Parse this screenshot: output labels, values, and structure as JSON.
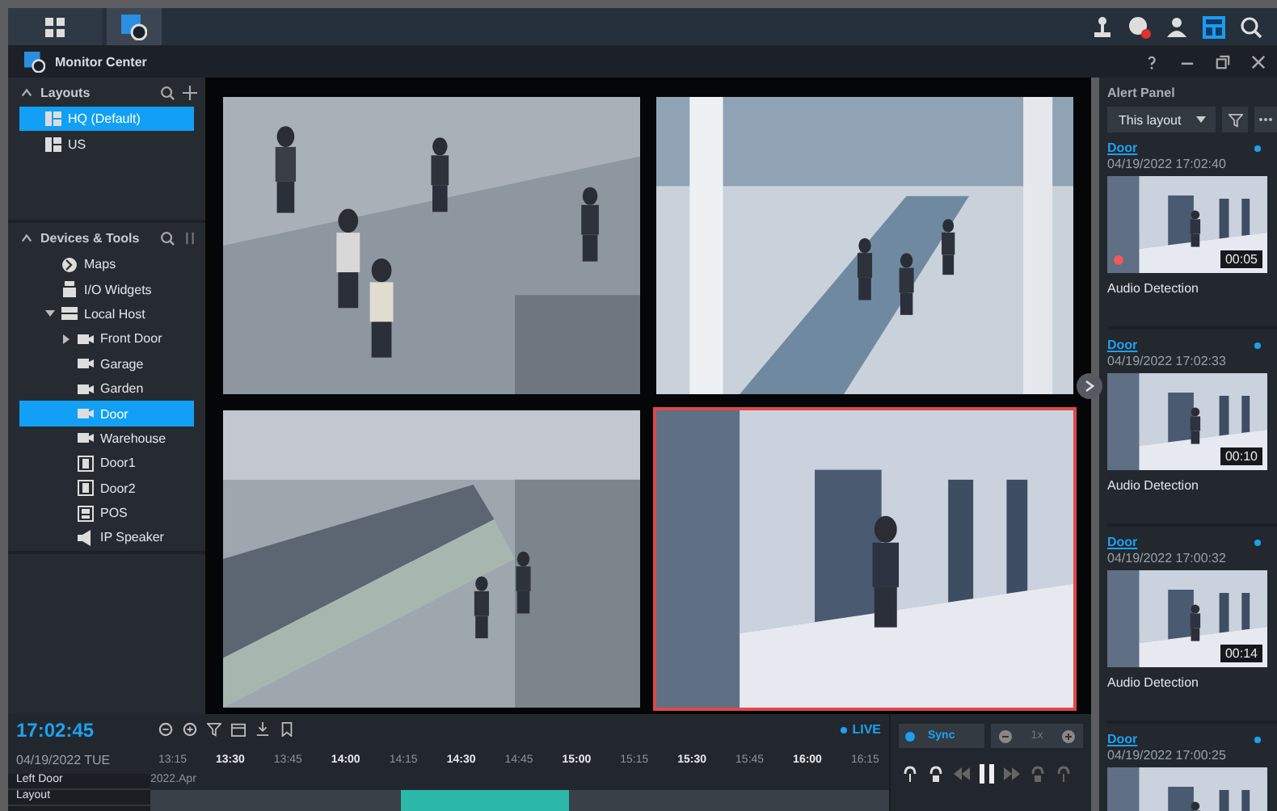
{
  "window": {
    "title": "Monitor Center"
  },
  "layouts": {
    "title": "Layouts",
    "items": [
      {
        "label": "HQ (Default)",
        "selected": true
      },
      {
        "label": "US",
        "selected": false
      }
    ]
  },
  "devices": {
    "title": "Devices & Tools",
    "items": [
      {
        "label": "Maps",
        "kind": "map",
        "selected": false
      },
      {
        "label": "I/O Widgets",
        "kind": "io",
        "selected": false
      },
      {
        "label": "Local Host",
        "kind": "host",
        "selected": false,
        "expanded": true,
        "children": [
          {
            "label": "Front Door",
            "kind": "camera",
            "selected": false,
            "expanded": false
          },
          {
            "label": "Garage",
            "kind": "camera",
            "selected": false
          },
          {
            "label": "Garden",
            "kind": "camera",
            "selected": false
          },
          {
            "label": "Door",
            "kind": "camera",
            "selected": true
          },
          {
            "label": "Warehouse",
            "kind": "camera",
            "selected": false
          },
          {
            "label": "Door1",
            "kind": "door",
            "selected": false
          },
          {
            "label": "Door2",
            "kind": "door",
            "selected": false
          },
          {
            "label": "POS",
            "kind": "pos",
            "selected": false
          },
          {
            "label": "IP Speaker",
            "kind": "speaker",
            "selected": false
          }
        ]
      }
    ]
  },
  "videos": [
    {
      "kind": "plaza",
      "selected": false
    },
    {
      "kind": "hall",
      "selected": false
    },
    {
      "kind": "escalator",
      "selected": false
    },
    {
      "kind": "door",
      "selected": true
    }
  ],
  "alert_panel": {
    "title": "Alert Panel",
    "filter": "This layout",
    "alerts": [
      {
        "camera": "Door",
        "time": "04/19/2022 17:02:40",
        "duration": "00:05",
        "type": "Audio Detection",
        "recording": true
      },
      {
        "camera": "Door",
        "time": "04/19/2022 17:02:33",
        "duration": "00:10",
        "type": "Audio Detection",
        "recording": false
      },
      {
        "camera": "Door",
        "time": "04/19/2022 17:00:32",
        "duration": "00:14",
        "type": "Audio Detection",
        "recording": false
      },
      {
        "camera": "Door",
        "time": "04/19/2022 17:00:25",
        "recording": false
      }
    ]
  },
  "timeline": {
    "clock": "17:02:45",
    "date": "04/19/2022 TUE",
    "live": "LIVE",
    "month": "2022.Apr",
    "ticks": [
      {
        "label": "13:15",
        "major": false
      },
      {
        "label": "13:30",
        "major": true
      },
      {
        "label": "13:45",
        "major": false
      },
      {
        "label": "14:00",
        "major": true
      },
      {
        "label": "14:15",
        "major": false
      },
      {
        "label": "14:30",
        "major": true
      },
      {
        "label": "14:45",
        "major": false
      },
      {
        "label": "15:00",
        "major": true
      },
      {
        "label": "15:15",
        "major": false
      },
      {
        "label": "15:30",
        "major": true
      },
      {
        "label": "15:45",
        "major": false
      },
      {
        "label": "16:00",
        "major": true
      },
      {
        "label": "16:15",
        "major": false
      }
    ],
    "tracks": [
      "Left Door",
      "Layout"
    ],
    "sync": {
      "label": "Sync",
      "on": true
    },
    "speed": "1x"
  }
}
